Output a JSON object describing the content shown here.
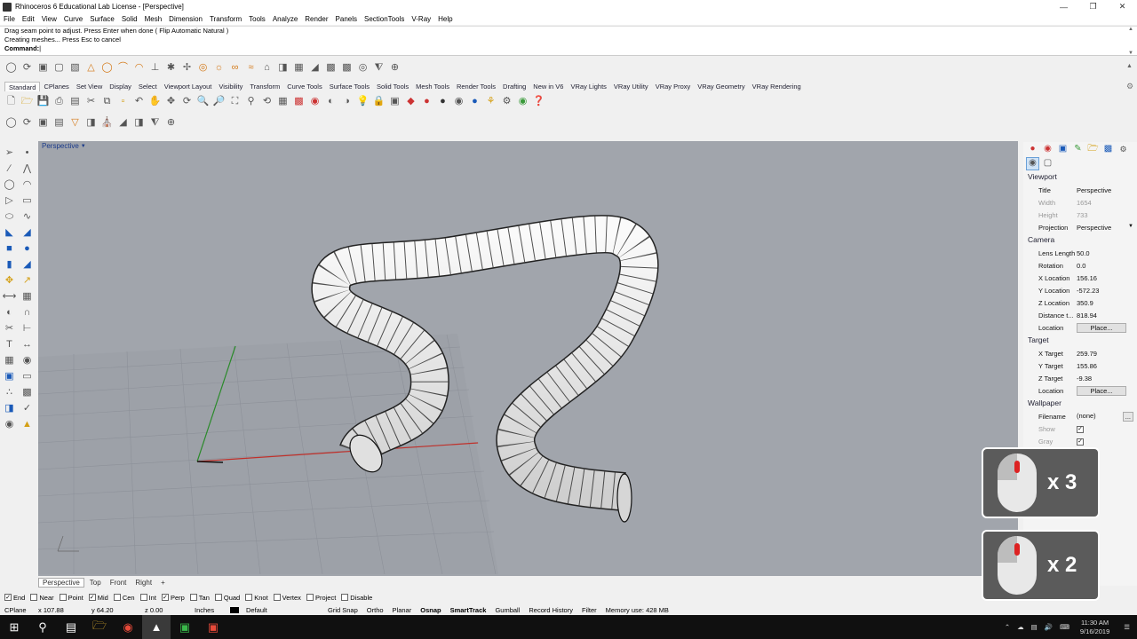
{
  "window": {
    "title": "Rhinoceros 6 Educational Lab License - [Perspective]",
    "controls": [
      "minimize-icon",
      "restore-icon",
      "close-icon"
    ]
  },
  "menu": [
    "File",
    "Edit",
    "View",
    "Curve",
    "Surface",
    "Solid",
    "Mesh",
    "Dimension",
    "Transform",
    "Tools",
    "Analyze",
    "Render",
    "Panels",
    "SectionTools",
    "V-Ray",
    "Help"
  ],
  "command": {
    "history": [
      "Drag seam point to adjust. Press Enter when done ( Flip  Automatic  Natural )",
      "Creating meshes... Press Esc to cancel"
    ],
    "prompt": "Command:"
  },
  "toolbar_tabs": [
    "Standard",
    "CPlanes",
    "Set View",
    "Display",
    "Select",
    "Viewport Layout",
    "Visibility",
    "Transform",
    "Curve Tools",
    "Surface Tools",
    "Solid Tools",
    "Mesh Tools",
    "Render Tools",
    "Drafting",
    "New in V6",
    "VRay Lights",
    "VRay Utility",
    "VRay Proxy",
    "VRay Geometry",
    "VRay Rendering"
  ],
  "viewport": {
    "label": "Perspective",
    "tabs": [
      "Perspective",
      "Top",
      "Front",
      "Right"
    ],
    "add_tab": "+"
  },
  "properties": {
    "sections": {
      "viewport": "Viewport",
      "camera": "Camera",
      "target": "Target",
      "wallpaper": "Wallpaper"
    },
    "viewport_rows": [
      {
        "k": "Title",
        "v": "Perspective"
      },
      {
        "k": "Width",
        "v": "1654"
      },
      {
        "k": "Height",
        "v": "733"
      },
      {
        "k": "Projection",
        "v": "Perspective"
      }
    ],
    "camera_rows": [
      {
        "k": "Lens Length",
        "v": "50.0"
      },
      {
        "k": "Rotation",
        "v": "0.0"
      },
      {
        "k": "X Location",
        "v": "156.16"
      },
      {
        "k": "Y Location",
        "v": "-572.23"
      },
      {
        "k": "Z Location",
        "v": "350.9"
      },
      {
        "k": "Distance t...",
        "v": "818.94"
      },
      {
        "k": "Location",
        "v": "Place..."
      }
    ],
    "target_rows": [
      {
        "k": "X Target",
        "v": "259.79"
      },
      {
        "k": "Y Target",
        "v": "155.86"
      },
      {
        "k": "Z Target",
        "v": "-9.38"
      },
      {
        "k": "Location",
        "v": "Place..."
      }
    ],
    "wallpaper_rows": [
      {
        "k": "Filename",
        "v": "(none)"
      },
      {
        "k": "Show",
        "v": ""
      },
      {
        "k": "Gray",
        "v": ""
      }
    ],
    "filename_more": "..."
  },
  "osnaps": [
    {
      "label": "End",
      "checked": true
    },
    {
      "label": "Near",
      "checked": false
    },
    {
      "label": "Point",
      "checked": false
    },
    {
      "label": "Mid",
      "checked": true
    },
    {
      "label": "Cen",
      "checked": false
    },
    {
      "label": "Int",
      "checked": false
    },
    {
      "label": "Perp",
      "checked": true
    },
    {
      "label": "Tan",
      "checked": false
    },
    {
      "label": "Quad",
      "checked": false
    },
    {
      "label": "Knot",
      "checked": false
    },
    {
      "label": "Vertex",
      "checked": false
    },
    {
      "label": "Project",
      "checked": false
    },
    {
      "label": "Disable",
      "checked": false
    }
  ],
  "status": {
    "cplane": "CPlane",
    "x": "x 107.88",
    "y": "y 64.20",
    "z": "z 0.00",
    "units": "Inches",
    "layer": "Default",
    "grid_snap": "Grid Snap",
    "ortho": "Ortho",
    "planar": "Planar",
    "osnap": "Osnap",
    "smarttrack": "SmartTrack",
    "gumball": "Gumball",
    "record_history": "Record History",
    "filter": "Filter",
    "memory": "Memory use: 428 MB"
  },
  "overlays": [
    {
      "count": "x 3"
    },
    {
      "count": "x 2"
    }
  ],
  "taskbar": {
    "time": "11:30 AM",
    "date": "9/16/2019"
  },
  "colors": {
    "viewport_bg": "#a1a5ac",
    "x_axis": "#c0302a",
    "y_axis": "#2a8a2a",
    "title_blue": "#1a3a8a"
  }
}
